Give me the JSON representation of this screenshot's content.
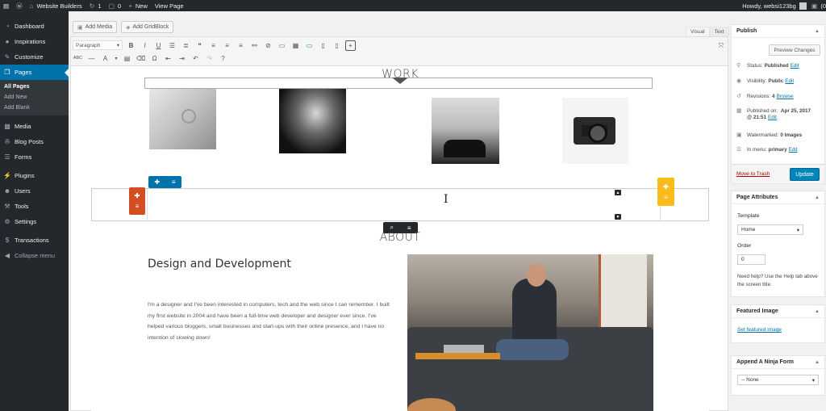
{
  "adminbar": {
    "site_name": "Website Builders",
    "updates_count": "1",
    "comments_count": "0",
    "new_label": "New",
    "view_page": "View Page",
    "howdy": "Howdy, websi123bg",
    "right_count": "(0"
  },
  "sidebar": {
    "items": [
      {
        "label": "Dashboard",
        "icon": "dashboard-icon"
      },
      {
        "label": "Inspirations",
        "icon": "lightbulb-icon"
      },
      {
        "label": "Customize",
        "icon": "brush-icon"
      },
      {
        "label": "Pages",
        "icon": "pages-icon"
      },
      {
        "label": "Media",
        "icon": "media-icon"
      },
      {
        "label": "Blog Posts",
        "icon": "pin-icon"
      },
      {
        "label": "Forms",
        "icon": "forms-icon"
      },
      {
        "label": "Plugins",
        "icon": "plugins-icon"
      },
      {
        "label": "Users",
        "icon": "users-icon"
      },
      {
        "label": "Tools",
        "icon": "wrench-icon"
      },
      {
        "label": "Settings",
        "icon": "settings-icon"
      },
      {
        "label": "Transactions",
        "icon": "transactions-icon"
      },
      {
        "label": "Collapse menu",
        "icon": "collapse-icon"
      }
    ],
    "submenu": [
      "All Pages",
      "Add New",
      "Add Blank"
    ]
  },
  "editor": {
    "add_media": "Add Media",
    "add_gridblock": "Add GridBlock",
    "tab_visual": "Visual",
    "tab_text": "Text",
    "format_select": "Paragraph",
    "abc": "ABC"
  },
  "content": {
    "work_heading": "WORK",
    "about_heading": "ABOUT",
    "about_title": "Design and Development",
    "about_text": "I'm a designer and I've been interested in computers, tech and the web since I can remember. I built my first website in 2004 and have been a full-time web developer and designer ever since. I've helped various bloggers, small businesses and start-ups with their online presence, and I have no intention of slowing down!"
  },
  "publish": {
    "title": "Publish",
    "preview": "Preview Changes",
    "status_label": "Status:",
    "status_value": "Published",
    "status_edit": "Edit",
    "visibility_label": "Visibility:",
    "visibility_value": "Public",
    "visibility_edit": "Edit",
    "revisions_label": "Revisions:",
    "revisions_value": "4",
    "revisions_browse": "Browse",
    "published_label": "Published on:",
    "published_value": "Apr 25, 2017",
    "published_time": "@ 21:51",
    "published_edit": "Edit",
    "watermarked_label": "Watermarked:",
    "watermarked_value": "0 Images",
    "menu_label": "In menu:",
    "menu_value": "primary",
    "menu_edit": "Edit",
    "trash": "Move to Trash",
    "update": "Update"
  },
  "page_attributes": {
    "title": "Page Attributes",
    "template_label": "Template",
    "template_value": "Home",
    "order_label": "Order",
    "order_value": "0",
    "help": "Need help? Use the Help tab above the screen title."
  },
  "featured_image": {
    "title": "Featured Image",
    "link": "Set featured image"
  },
  "ninja_form": {
    "title": "Append A Ninja Form",
    "value": "-- None"
  }
}
